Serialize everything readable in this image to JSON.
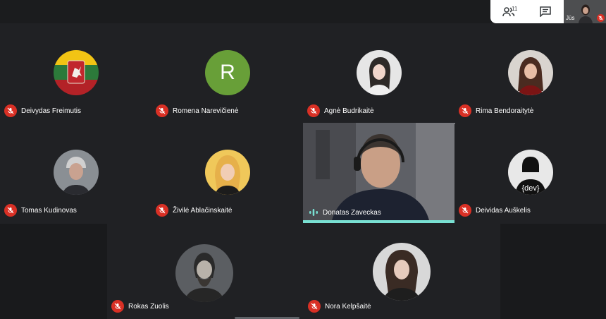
{
  "toolbar": {
    "people_icon": "people-icon",
    "participant_count": "11",
    "chat_icon": "chat-icon"
  },
  "self_view": {
    "label": "Jūs"
  },
  "participants": [
    {
      "name": "Deivydas Freimutis",
      "avatar": "flag-coat-of-arms",
      "muted": true
    },
    {
      "name": "Romena Narevičienė",
      "avatar_letter": "R",
      "avatar_color": "#689f38",
      "muted": true
    },
    {
      "name": "Agnė Budrikaitė",
      "avatar": "photo",
      "muted": true
    },
    {
      "name": "Rima Bendoraitytė",
      "avatar": "photo",
      "muted": true
    },
    {
      "name": "Tomas Kudinovas",
      "avatar": "photo",
      "muted": true
    },
    {
      "name": "Živilė Ablačinskaitė",
      "avatar": "photo",
      "muted": true
    },
    {
      "name": "Donatas Zaveckas",
      "avatar": "video",
      "muted": false,
      "speaking": true
    },
    {
      "name": "Deividas Auškelis",
      "avatar": "dev-avatar",
      "avatar_text": "{dev}",
      "muted": true
    },
    {
      "name": "Rokas Zuolis",
      "avatar": "photo",
      "muted": true
    },
    {
      "name": "Nora Kelpšaitė",
      "avatar": "photo",
      "muted": true
    }
  ],
  "colors": {
    "accent_speaking": "#79e1d3",
    "muted_red": "#d93025",
    "background": "#202124"
  }
}
